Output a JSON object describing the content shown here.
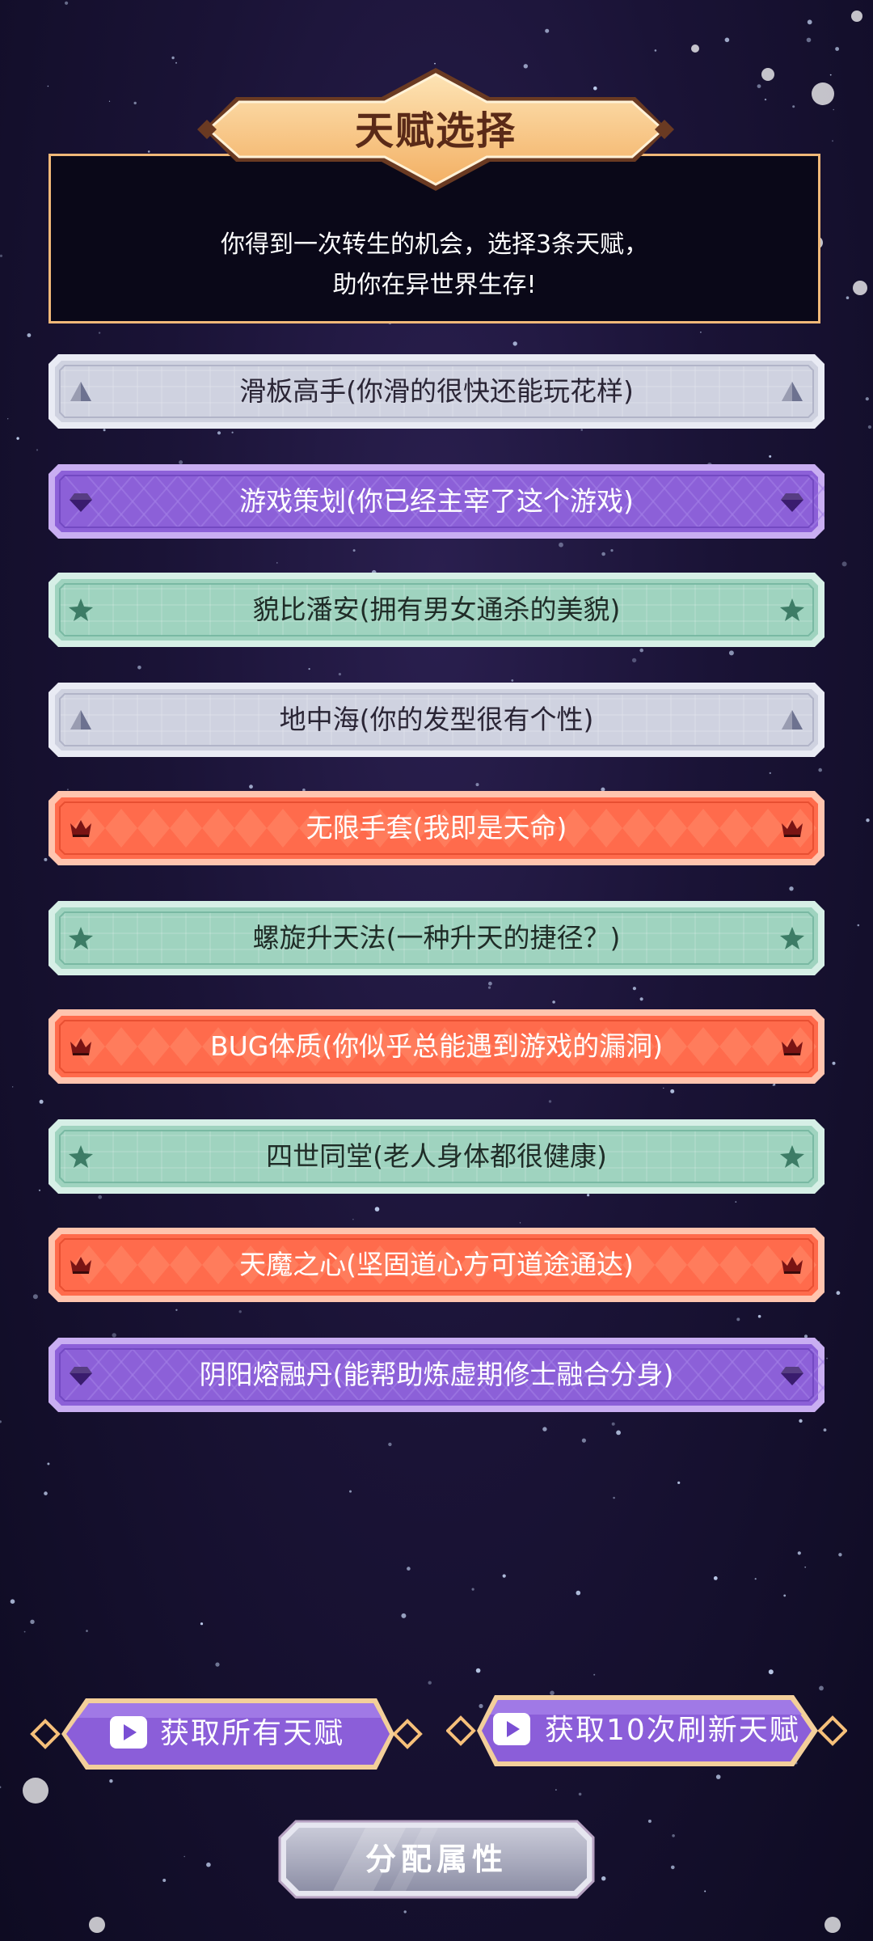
{
  "header": {
    "title": "天赋选择",
    "desc_line1": "你得到一次转生的机会，选择3条天赋，",
    "desc_line2": "助你在异世界生存!"
  },
  "talents": [
    {
      "label": "滑板高手(你滑的很快还能玩花样)",
      "rarity": "common",
      "icon": "triangle-icon"
    },
    {
      "label": "游戏策划(你已经主宰了这个游戏)",
      "rarity": "epic",
      "icon": "diamond-icon"
    },
    {
      "label": "貌比潘安(拥有男女通杀的美貌)",
      "rarity": "rare",
      "icon": "star-icon"
    },
    {
      "label": "地中海(你的发型很有个性)",
      "rarity": "common",
      "icon": "triangle-icon"
    },
    {
      "label": "无限手套(我即是天命)",
      "rarity": "legendary",
      "icon": "crown-icon"
    },
    {
      "label": "螺旋升天法(一种升天的捷径？)",
      "rarity": "rare",
      "icon": "star-icon"
    },
    {
      "label": "BUG体质(你似乎总能遇到游戏的漏洞)",
      "rarity": "legendary",
      "icon": "crown-icon"
    },
    {
      "label": "四世同堂(老人身体都很健康)",
      "rarity": "rare",
      "icon": "star-icon"
    },
    {
      "label": "天魔之心(坚固道心方可道途通达)",
      "rarity": "legendary",
      "icon": "crown-icon"
    },
    {
      "label": "阴阳熔融丹(能帮助炼虚期修士融合分身)",
      "rarity": "epic",
      "icon": "diamond-icon"
    }
  ],
  "buttons": {
    "get_all": "获取所有天赋",
    "refresh": "获取10次刷新天赋",
    "allocate": "分配属性"
  },
  "colors": {
    "common": "#d0d3e2",
    "epic": "#8e62d6",
    "rare": "#9fd2bf",
    "legendary": "#ff6a4a",
    "title_gold": "#f6c07a"
  }
}
